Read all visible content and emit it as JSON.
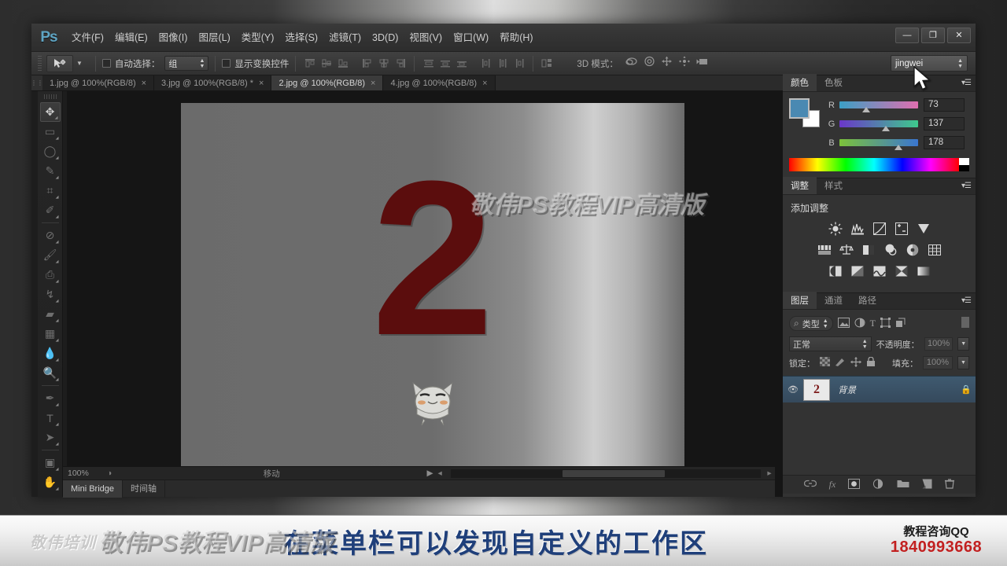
{
  "app": {
    "logo": "Ps",
    "menu": [
      "文件(F)",
      "编辑(E)",
      "图像(I)",
      "图层(L)",
      "类型(Y)",
      "选择(S)",
      "滤镜(T)",
      "3D(D)",
      "视图(V)",
      "窗口(W)",
      "帮助(H)"
    ],
    "window_buttons": {
      "minimize": "—",
      "maximize": "❐",
      "close": "✕"
    }
  },
  "options_bar": {
    "tool_icon": "move-tool",
    "auto_select_label": "自动选择：",
    "auto_select_value": "组",
    "show_transform_label": "显示变换控件",
    "mode3d_label": "3D 模式：",
    "workspace": "jingwei"
  },
  "tabs": [
    {
      "label": "1.jpg @ 100%(RGB/8)",
      "close": "×",
      "active": false
    },
    {
      "label": "3.jpg @ 100%(RGB/8) *",
      "close": "×",
      "active": false
    },
    {
      "label": "2.jpg @ 100%(RGB/8)",
      "close": "×",
      "active": true
    },
    {
      "label": "4.jpg @ 100%(RGB/8)",
      "close": "×",
      "active": false
    }
  ],
  "toolbar": {
    "tools": [
      {
        "name": "move-tool",
        "glyph": "✥",
        "selected": true
      },
      {
        "name": "marquee-tool",
        "glyph": "▭",
        "selected": false
      },
      {
        "name": "lasso-tool",
        "glyph": "◯",
        "selected": false
      },
      {
        "name": "quick-selection-tool",
        "glyph": "✎",
        "selected": false
      },
      {
        "name": "crop-tool",
        "glyph": "⌗",
        "selected": false
      },
      {
        "name": "eyedropper-tool",
        "glyph": "✐",
        "selected": false
      },
      {
        "name": "healing-brush-tool",
        "glyph": "⊘",
        "selected": false
      },
      {
        "name": "brush-tool",
        "glyph": "🖌",
        "selected": false
      },
      {
        "name": "clone-stamp-tool",
        "glyph": "⎙",
        "selected": false
      },
      {
        "name": "history-brush-tool",
        "glyph": "↯",
        "selected": false
      },
      {
        "name": "eraser-tool",
        "glyph": "▰",
        "selected": false
      },
      {
        "name": "gradient-tool",
        "glyph": "▦",
        "selected": false
      },
      {
        "name": "blur-tool",
        "glyph": "💧",
        "selected": false
      },
      {
        "name": "dodge-tool",
        "glyph": "🔍",
        "selected": false
      },
      {
        "name": "pen-tool",
        "glyph": "✒",
        "selected": false
      },
      {
        "name": "type-tool",
        "glyph": "T",
        "selected": false
      },
      {
        "name": "path-selection-tool",
        "glyph": "➤",
        "selected": false
      },
      {
        "name": "rectangle-tool",
        "glyph": "▣",
        "selected": false
      },
      {
        "name": "hand-tool",
        "glyph": "✋",
        "selected": false
      }
    ]
  },
  "canvas": {
    "number": "2",
    "watermark_top": "敬伟PS教程VIP高清版",
    "watermark_bottom": "敬伟PS教程VIP高清版"
  },
  "status_bar": {
    "zoom": "100%",
    "doc_info": "移动",
    "arrow_right": "▶",
    "arrow_left": "◂"
  },
  "bottom_dock": {
    "tabs": [
      {
        "label": "Mini Bridge",
        "active": true
      },
      {
        "label": "时间轴",
        "active": false
      }
    ]
  },
  "color_panel": {
    "tabs": [
      {
        "label": "颜色",
        "active": true
      },
      {
        "label": "色板",
        "active": false
      }
    ],
    "menu_icon": "panel-menu-icon",
    "channels": [
      {
        "label": "R",
        "value": "73",
        "pos": 29
      },
      {
        "label": "G",
        "value": "137",
        "pos": 54
      },
      {
        "label": "B",
        "value": "178",
        "pos": 70
      }
    ],
    "foreground": "#4a89b2",
    "background": "#ffffff"
  },
  "adjustments_panel": {
    "tabs": [
      {
        "label": "调整",
        "active": true
      },
      {
        "label": "样式",
        "active": false
      }
    ],
    "title": "添加调整",
    "row1": [
      "☀",
      "▥",
      "◪",
      "±",
      "▼"
    ],
    "row2": [
      "▤",
      "⚖",
      "◨",
      "◕",
      "◍",
      "▦"
    ],
    "row3": [
      "◑",
      "◩",
      "〜",
      "⧗",
      "▬"
    ]
  },
  "layers_panel": {
    "tabs": [
      {
        "label": "图层",
        "active": true
      },
      {
        "label": "通道",
        "active": false
      },
      {
        "label": "路径",
        "active": false
      }
    ],
    "filter_label": "类型",
    "filter_icons": [
      "image-filter-icon",
      "adjustment-filter-icon",
      "type-filter-icon",
      "shape-filter-icon",
      "smartobject-filter-icon"
    ],
    "blend_mode": "正常",
    "opacity_label": "不透明度：",
    "opacity_value": "100%",
    "lock_label": "锁定：",
    "lock_icons": [
      "lock-transparent-icon",
      "lock-image-icon",
      "lock-position-icon",
      "lock-all-icon"
    ],
    "fill_label": "填充：",
    "fill_value": "100%",
    "layers": [
      {
        "visible": true,
        "thumb_text": "2",
        "name": "背景",
        "locked": true
      }
    ],
    "footer_icons": [
      "link-icon",
      "fx-icon",
      "mask-icon",
      "adjustment-layer-icon",
      "group-icon",
      "new-layer-icon",
      "delete-icon"
    ]
  },
  "banner": {
    "logo": "敬伟培训",
    "caption": "在菜单栏可以发现自定义的工作区",
    "qq_label": "教程咨询QQ",
    "qq_number": "1840993668"
  },
  "colors": {
    "banner_text": "#1f3f7a",
    "qq_number": "#c22020",
    "layer_selected": "#3f5a70",
    "ps_logo": "#5fa5c4",
    "canvas_number": "#5b0d0d"
  }
}
